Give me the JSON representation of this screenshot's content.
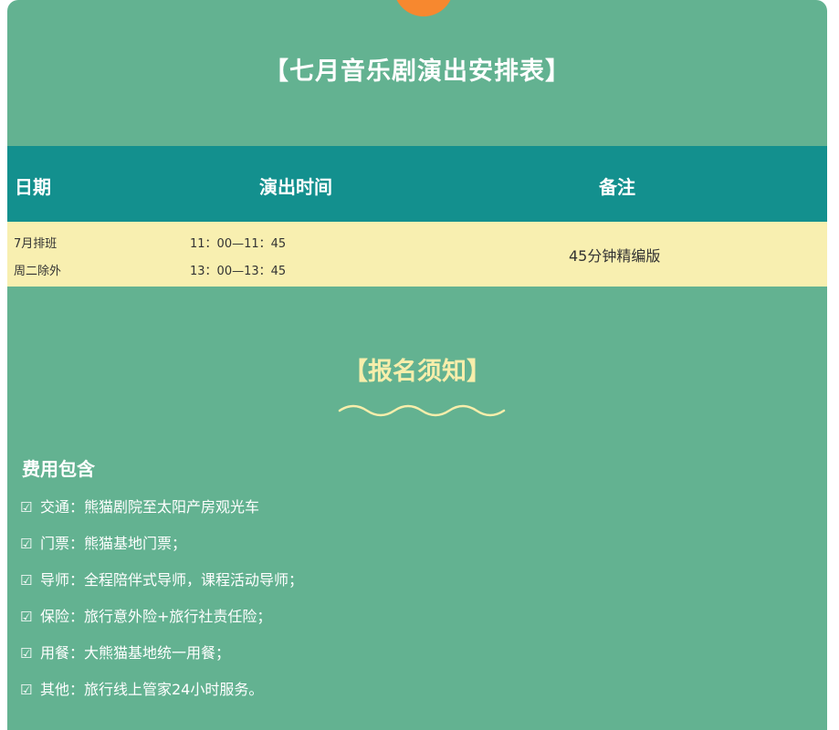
{
  "header": {
    "title": "【七月音乐剧演出安排表】",
    "accent_dot_color": "#f7882f"
  },
  "schedule_table": {
    "columns": [
      "日期",
      "演出时间",
      "备注"
    ],
    "rows": [
      {
        "date": [
          "7月排班",
          "周二除外"
        ],
        "times": [
          "11：00—11：45",
          "13：00—13：45"
        ],
        "note": "45分钟精编版"
      }
    ]
  },
  "signup": {
    "title": "【报名须知】",
    "fees_heading": "费用包含",
    "check_icon": "☑",
    "fee_items": [
      "交通：熊猫剧院至太阳产房观光车",
      "门票：熊猫基地门票；",
      "导师：全程陪伴式导师，课程活动导师；",
      "保险：旅行意外险+旅行社责任险；",
      "用餐：大熊猫基地统一用餐；",
      "其他：旅行线上管家24小时服务。"
    ]
  },
  "colors": {
    "background": "#63b291",
    "table_header": "#13908e",
    "table_row": "#f8efb0",
    "highlight_text": "#f7eeab"
  }
}
